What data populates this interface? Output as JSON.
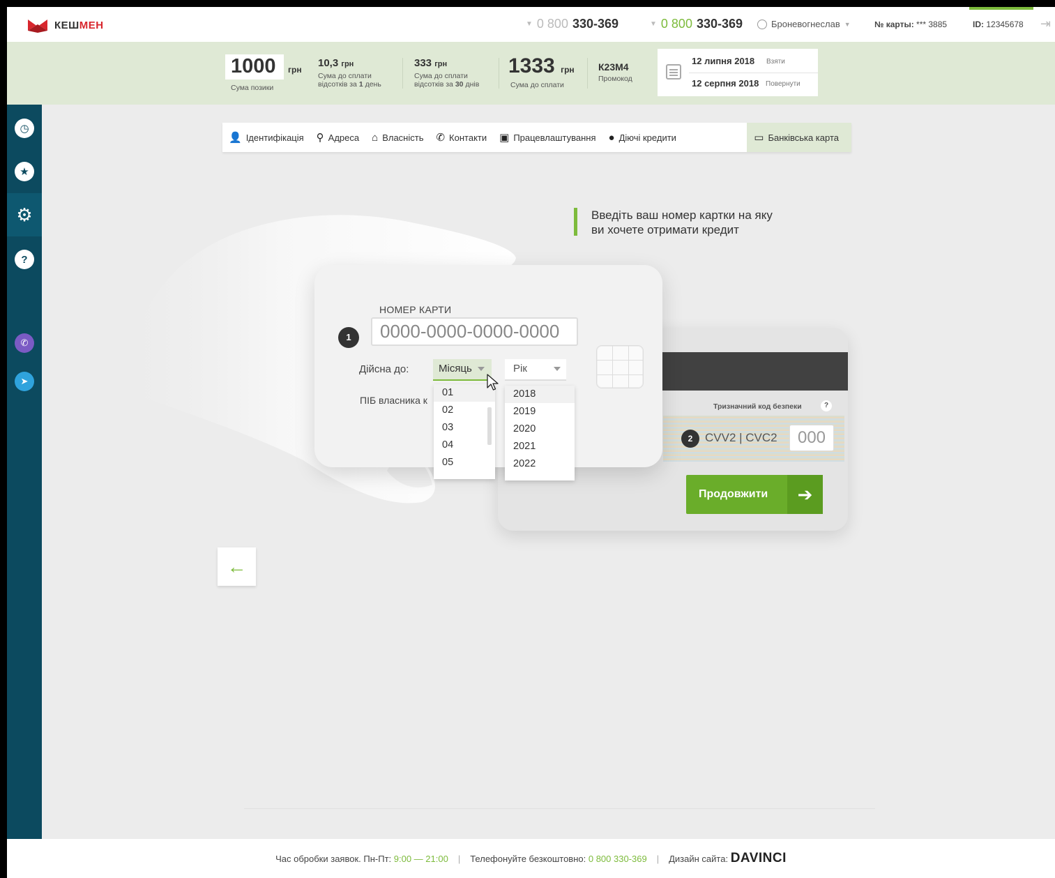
{
  "header": {
    "logo_part1": "КЕШ",
    "logo_part2": "МЕН",
    "phone1": {
      "prefix": "0 800",
      "number": "330-369"
    },
    "phone2": {
      "prefix": "0 800",
      "number": "330-369"
    },
    "user_name": "Броневогнеслав",
    "card_label": "№ карты:",
    "card_value": "*** 3885",
    "id_label": "ID:",
    "id_value": "12345678"
  },
  "summary": {
    "loan_amount": "1000",
    "loan_currency": "грн",
    "loan_label": "Сума позики",
    "daily_amount": "10,3",
    "daily_currency": "грн",
    "daily_label_1": "Сума до сплати",
    "daily_label_2_pre": "відсотків за",
    "daily_label_2_num": "1",
    "daily_label_2_post": "день",
    "monthly_amount": "333",
    "monthly_currency": "грн",
    "monthly_label_1": "Сума до сплати",
    "monthly_label_2_pre": "відсотків за",
    "monthly_label_2_num": "30",
    "monthly_label_2_post": "днів",
    "total_amount": "1333",
    "total_currency": "грн",
    "total_label": "Сума до сплати",
    "promo_code": "К23М4",
    "promo_label": "Промокод",
    "date_take": "12 липня 2018",
    "date_take_label": "Взяти",
    "date_return": "12 серпня 2018",
    "date_return_label": "Повернути"
  },
  "tabs": [
    {
      "label": "Ідентифікація",
      "icon": "person-icon"
    },
    {
      "label": "Адреса",
      "icon": "map-pin-icon"
    },
    {
      "label": "Власність",
      "icon": "home-icon"
    },
    {
      "label": "Контакти",
      "icon": "phone-icon"
    },
    {
      "label": "Працевлаштування",
      "icon": "briefcase-icon"
    },
    {
      "label": "Діючі кредити",
      "icon": "hryvnia-icon"
    },
    {
      "label": "Банківська карта",
      "icon": "card-icon"
    }
  ],
  "active_tab": "Банківська карта",
  "main": {
    "heading_line1": "Введіть ваш номер картки на яку",
    "heading_line2": "ви хочете отримати кредит",
    "card_number_label": "НОМЕР КАРТИ",
    "step1": "1",
    "card_number_placeholder": "0000-0000-0000-0000",
    "valid_label": "Дійсна до:",
    "month_select": "Місяць",
    "year_select": "Рік",
    "holder_label": "ПІБ власника к",
    "month_options": [
      "01",
      "02",
      "03",
      "04",
      "05"
    ],
    "year_options": [
      "2018",
      "2019",
      "2020",
      "2021",
      "2022"
    ],
    "security_label": "Тризначний код безпеки",
    "security_help": "?",
    "step2": "2",
    "cvv_label": "CVV2 | CVC2",
    "cvv_placeholder": "000",
    "continue_label": "Продовжити"
  },
  "footer": {
    "hours_label": "Час обробки заявок. Пн-Пт:",
    "hours_value": "9:00 — 21:00",
    "phone_label": "Телефонуйте безкоштовно:",
    "phone_value": "0 800 330-369",
    "design_label": "Дизайн сайта:",
    "design_brand": "DAVINCI"
  },
  "colors": {
    "accent_green": "#7dbb3c",
    "button_green": "#6aad2a",
    "sidebar": "#0c4a5f",
    "summary_bg": "#dfe9d5",
    "logo_red": "#d8262d"
  }
}
